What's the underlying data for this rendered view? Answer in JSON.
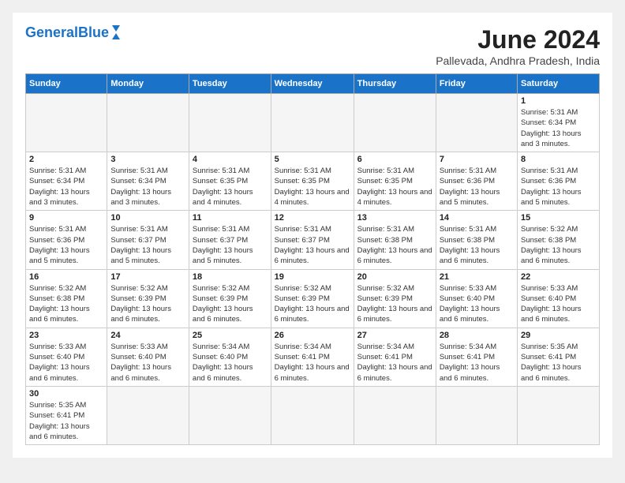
{
  "header": {
    "logo_general": "General",
    "logo_blue": "Blue",
    "title": "June 2024",
    "location": "Pallevada, Andhra Pradesh, India"
  },
  "weekdays": [
    "Sunday",
    "Monday",
    "Tuesday",
    "Wednesday",
    "Thursday",
    "Friday",
    "Saturday"
  ],
  "weeks": [
    [
      {
        "day": "",
        "info": ""
      },
      {
        "day": "",
        "info": ""
      },
      {
        "day": "",
        "info": ""
      },
      {
        "day": "",
        "info": ""
      },
      {
        "day": "",
        "info": ""
      },
      {
        "day": "",
        "info": ""
      },
      {
        "day": "1",
        "info": "Sunrise: 5:31 AM\nSunset: 6:34 PM\nDaylight: 13 hours and 3 minutes."
      }
    ],
    [
      {
        "day": "2",
        "info": "Sunrise: 5:31 AM\nSunset: 6:34 PM\nDaylight: 13 hours and 3 minutes."
      },
      {
        "day": "3",
        "info": "Sunrise: 5:31 AM\nSunset: 6:34 PM\nDaylight: 13 hours and 3 minutes."
      },
      {
        "day": "4",
        "info": "Sunrise: 5:31 AM\nSunset: 6:35 PM\nDaylight: 13 hours and 4 minutes."
      },
      {
        "day": "5",
        "info": "Sunrise: 5:31 AM\nSunset: 6:35 PM\nDaylight: 13 hours and 4 minutes."
      },
      {
        "day": "6",
        "info": "Sunrise: 5:31 AM\nSunset: 6:35 PM\nDaylight: 13 hours and 4 minutes."
      },
      {
        "day": "7",
        "info": "Sunrise: 5:31 AM\nSunset: 6:36 PM\nDaylight: 13 hours and 5 minutes."
      },
      {
        "day": "8",
        "info": "Sunrise: 5:31 AM\nSunset: 6:36 PM\nDaylight: 13 hours and 5 minutes."
      }
    ],
    [
      {
        "day": "9",
        "info": "Sunrise: 5:31 AM\nSunset: 6:36 PM\nDaylight: 13 hours and 5 minutes."
      },
      {
        "day": "10",
        "info": "Sunrise: 5:31 AM\nSunset: 6:37 PM\nDaylight: 13 hours and 5 minutes."
      },
      {
        "day": "11",
        "info": "Sunrise: 5:31 AM\nSunset: 6:37 PM\nDaylight: 13 hours and 5 minutes."
      },
      {
        "day": "12",
        "info": "Sunrise: 5:31 AM\nSunset: 6:37 PM\nDaylight: 13 hours and 6 minutes."
      },
      {
        "day": "13",
        "info": "Sunrise: 5:31 AM\nSunset: 6:38 PM\nDaylight: 13 hours and 6 minutes."
      },
      {
        "day": "14",
        "info": "Sunrise: 5:31 AM\nSunset: 6:38 PM\nDaylight: 13 hours and 6 minutes."
      },
      {
        "day": "15",
        "info": "Sunrise: 5:32 AM\nSunset: 6:38 PM\nDaylight: 13 hours and 6 minutes."
      }
    ],
    [
      {
        "day": "16",
        "info": "Sunrise: 5:32 AM\nSunset: 6:38 PM\nDaylight: 13 hours and 6 minutes."
      },
      {
        "day": "17",
        "info": "Sunrise: 5:32 AM\nSunset: 6:39 PM\nDaylight: 13 hours and 6 minutes."
      },
      {
        "day": "18",
        "info": "Sunrise: 5:32 AM\nSunset: 6:39 PM\nDaylight: 13 hours and 6 minutes."
      },
      {
        "day": "19",
        "info": "Sunrise: 5:32 AM\nSunset: 6:39 PM\nDaylight: 13 hours and 6 minutes."
      },
      {
        "day": "20",
        "info": "Sunrise: 5:32 AM\nSunset: 6:39 PM\nDaylight: 13 hours and 6 minutes."
      },
      {
        "day": "21",
        "info": "Sunrise: 5:33 AM\nSunset: 6:40 PM\nDaylight: 13 hours and 6 minutes."
      },
      {
        "day": "22",
        "info": "Sunrise: 5:33 AM\nSunset: 6:40 PM\nDaylight: 13 hours and 6 minutes."
      }
    ],
    [
      {
        "day": "23",
        "info": "Sunrise: 5:33 AM\nSunset: 6:40 PM\nDaylight: 13 hours and 6 minutes."
      },
      {
        "day": "24",
        "info": "Sunrise: 5:33 AM\nSunset: 6:40 PM\nDaylight: 13 hours and 6 minutes."
      },
      {
        "day": "25",
        "info": "Sunrise: 5:34 AM\nSunset: 6:40 PM\nDaylight: 13 hours and 6 minutes."
      },
      {
        "day": "26",
        "info": "Sunrise: 5:34 AM\nSunset: 6:41 PM\nDaylight: 13 hours and 6 minutes."
      },
      {
        "day": "27",
        "info": "Sunrise: 5:34 AM\nSunset: 6:41 PM\nDaylight: 13 hours and 6 minutes."
      },
      {
        "day": "28",
        "info": "Sunrise: 5:34 AM\nSunset: 6:41 PM\nDaylight: 13 hours and 6 minutes."
      },
      {
        "day": "29",
        "info": "Sunrise: 5:35 AM\nSunset: 6:41 PM\nDaylight: 13 hours and 6 minutes."
      }
    ],
    [
      {
        "day": "30",
        "info": "Sunrise: 5:35 AM\nSunset: 6:41 PM\nDaylight: 13 hours and 6 minutes."
      },
      {
        "day": "",
        "info": ""
      },
      {
        "day": "",
        "info": ""
      },
      {
        "day": "",
        "info": ""
      },
      {
        "day": "",
        "info": ""
      },
      {
        "day": "",
        "info": ""
      },
      {
        "day": "",
        "info": ""
      }
    ]
  ]
}
